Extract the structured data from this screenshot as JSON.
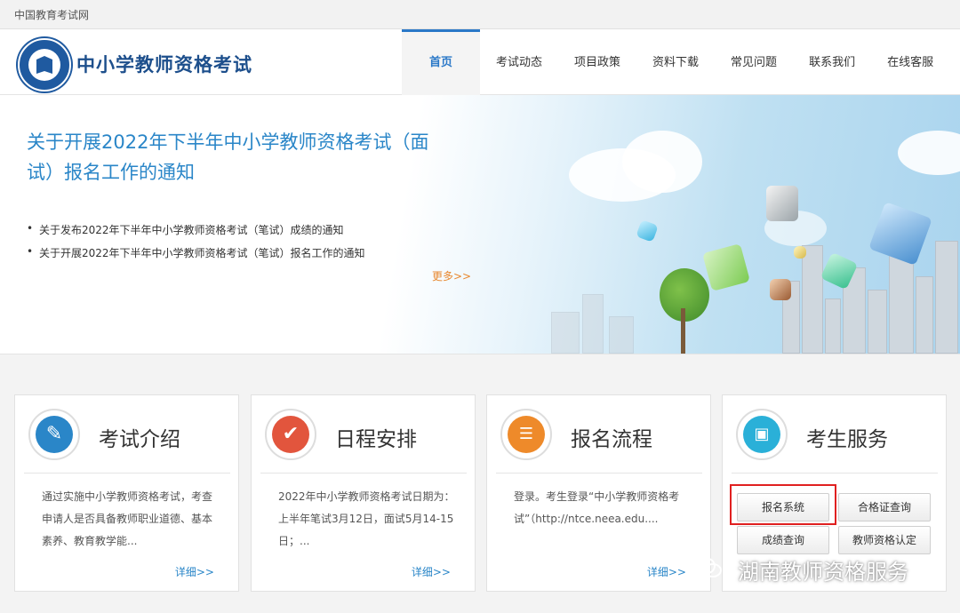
{
  "topbar": {
    "site_name": "中国教育考试网"
  },
  "header": {
    "title": "中小学教师资格考试",
    "nav": [
      {
        "label": "首页",
        "active": true
      },
      {
        "label": "考试动态"
      },
      {
        "label": "项目政策"
      },
      {
        "label": "资料下载"
      },
      {
        "label": "常见问题"
      },
      {
        "label": "联系我们"
      },
      {
        "label": "在线客服"
      }
    ]
  },
  "banner": {
    "headline": "关于开展2022年下半年中小学教师资格考试（面试）报名工作的通知",
    "news": [
      "关于发布2022年下半年中小学教师资格考试（笔试）成绩的通知",
      "关于开展2022年下半年中小学教师资格考试（笔试）报名工作的通知"
    ],
    "more_label": "更多>>"
  },
  "cards": [
    {
      "title": "考试介绍",
      "desc": "通过实施中小学教师资格考试，考查申请人是否具备教师职业道德、基本素养、教育教学能...",
      "detail": "详细>>",
      "icon": "document-edit-icon",
      "color": "#2a86c8"
    },
    {
      "title": "日程安排",
      "desc": "2022年中小学教师资格考试日期为：上半年笔试3月12日，面试5月14-15日；...",
      "detail": "详细>>",
      "icon": "checkmark-icon",
      "color": "#e2553d"
    },
    {
      "title": "报名流程",
      "desc": "登录。考生登录“中小学教师资格考试”（http://ntce.neea.edu....",
      "detail": "详细>>",
      "icon": "registration-form-icon",
      "color": "#ee8a2a"
    },
    {
      "title": "考生服务",
      "icon": "contact-book-icon",
      "color": "#2ab0d8"
    }
  ],
  "services": {
    "register": "报名系统",
    "certificate_query": "合格证查询",
    "score_query": "成绩查询",
    "qualification": "教师资格认定"
  },
  "watermark": {
    "text": "湖南教师资格服务"
  }
}
